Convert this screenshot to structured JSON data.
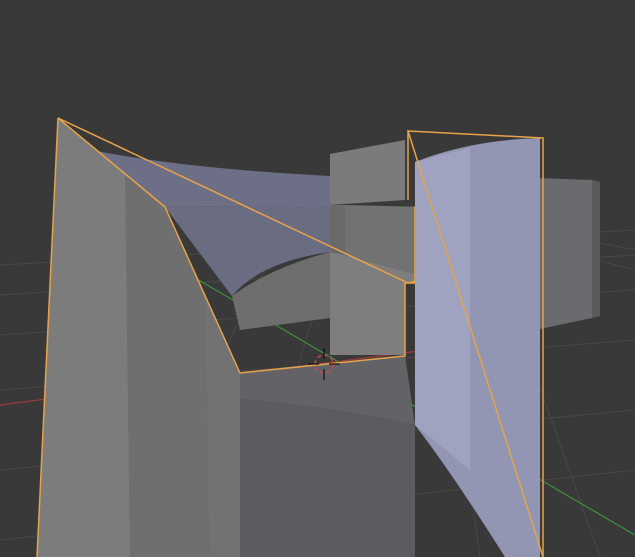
{
  "viewport": {
    "background_color": "#393939",
    "grid_color": "#4a4a4a",
    "x_axis_color": "#9b3a3a",
    "y_axis_color": "#3f8f3f"
  },
  "selection": {
    "outline_color": "#e8a24a",
    "faces_selected": 2
  },
  "mesh": {
    "face_color_light": "#8f92a8",
    "face_color_dark": "#6f7286",
    "face_color_gray": "#7a7a7a"
  },
  "cursor": {
    "icon": "3d-cursor-icon",
    "ring_color": "#c94a4a"
  }
}
